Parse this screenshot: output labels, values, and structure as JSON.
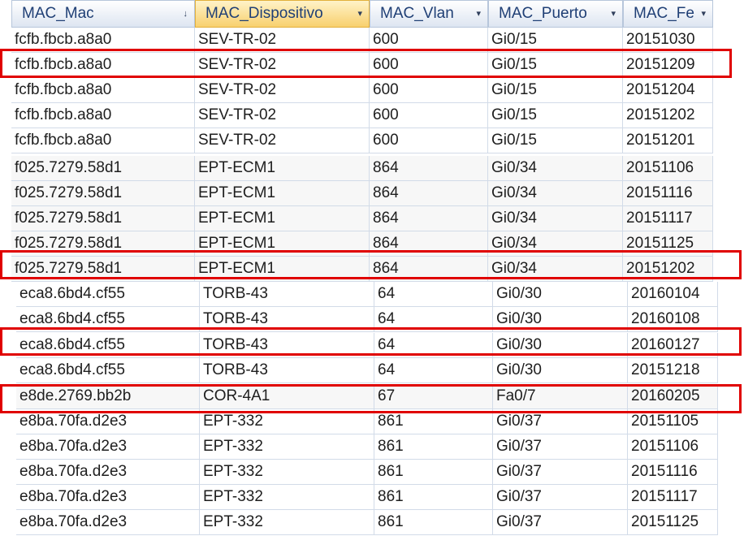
{
  "columns": [
    {
      "label": "MAC_Mac",
      "arrow": "↓",
      "selected": false
    },
    {
      "label": "MAC_Dispositivo",
      "arrow": "▾",
      "selected": true
    },
    {
      "label": "MAC_Vlan",
      "arrow": "▾",
      "selected": false
    },
    {
      "label": "MAC_Puerto",
      "arrow": "▾",
      "selected": false
    },
    {
      "label": "MAC_Fe",
      "arrow": "▾",
      "selected": false
    }
  ],
  "rows": [
    [
      "fcfb.fbcb.a8a0",
      "SEV-TR-02",
      "600",
      "Gi0/15",
      "20151030"
    ],
    [
      "fcfb.fbcb.a8a0",
      "SEV-TR-02",
      "600",
      "Gi0/15",
      "20151209"
    ],
    [
      "fcfb.fbcb.a8a0",
      "SEV-TR-02",
      "600",
      "Gi0/15",
      "20151204"
    ],
    [
      "fcfb.fbcb.a8a0",
      "SEV-TR-02",
      "600",
      "Gi0/15",
      "20151202"
    ],
    [
      "fcfb.fbcb.a8a0",
      "SEV-TR-02",
      "600",
      "Gi0/15",
      "20151201"
    ],
    [
      "f025.7279.58d1",
      "EPT-ECM1",
      "864",
      "Gi0/34",
      "20151106"
    ],
    [
      "f025.7279.58d1",
      "EPT-ECM1",
      "864",
      "Gi0/34",
      "20151116"
    ],
    [
      "f025.7279.58d1",
      "EPT-ECM1",
      "864",
      "Gi0/34",
      "20151117"
    ],
    [
      "f025.7279.58d1",
      "EPT-ECM1",
      "864",
      "Gi0/34",
      "20151125"
    ],
    [
      "f025.7279.58d1",
      "EPT-ECM1",
      "864",
      "Gi0/34",
      "20151202"
    ],
    [
      "eca8.6bd4.cf55",
      "TORB-43",
      "64",
      "Gi0/30",
      "20160104"
    ],
    [
      "eca8.6bd4.cf55",
      "TORB-43",
      "64",
      "Gi0/30",
      "20160108"
    ],
    [
      "eca8.6bd4.cf55",
      "TORB-43",
      "64",
      "Gi0/30",
      "20160127"
    ],
    [
      "eca8.6bd4.cf55",
      "TORB-43",
      "64",
      "Gi0/30",
      "20151218"
    ],
    [
      "e8de.2769.bb2b",
      "COR-4A1",
      "67",
      "Fa0/7",
      "20160205"
    ],
    [
      "e8ba.70fa.d2e3",
      "EPT-332",
      "861",
      "Gi0/37",
      "20151105"
    ],
    [
      "e8ba.70fa.d2e3",
      "EPT-332",
      "861",
      "Gi0/37",
      "20151106"
    ],
    [
      "e8ba.70fa.d2e3",
      "EPT-332",
      "861",
      "Gi0/37",
      "20151116"
    ],
    [
      "e8ba.70fa.d2e3",
      "EPT-332",
      "861",
      "Gi0/37",
      "20151117"
    ],
    [
      "e8ba.70fa.d2e3",
      "EPT-332",
      "861",
      "Gi0/37",
      "20151125"
    ]
  ],
  "colors": {
    "highlight": "#e00000",
    "header_selected": "#f8d06e",
    "header": "#dde5f1"
  }
}
